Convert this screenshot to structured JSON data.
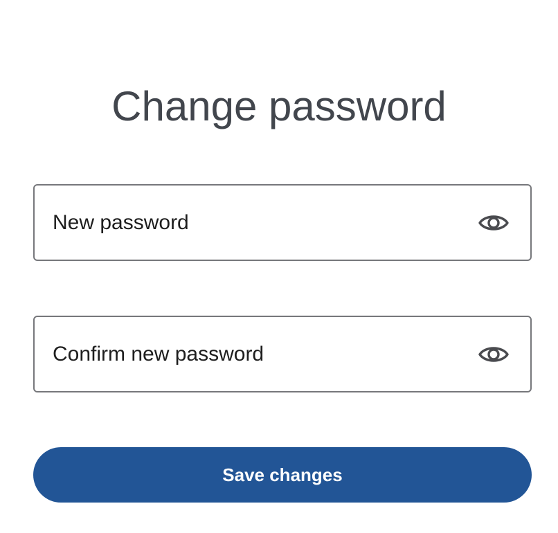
{
  "page": {
    "title": "Change password"
  },
  "form": {
    "new_password": {
      "value": "",
      "placeholder": "New password",
      "toggle_icon": "eye-icon"
    },
    "confirm_password": {
      "value": "",
      "placeholder": "Confirm new password",
      "toggle_icon": "eye-icon"
    },
    "submit_label": "Save changes"
  },
  "colors": {
    "title_text": "#42464d",
    "field_border": "#76777b",
    "icon": "#4a4b4f",
    "primary_button": "#225596",
    "button_text": "#ffffff"
  }
}
